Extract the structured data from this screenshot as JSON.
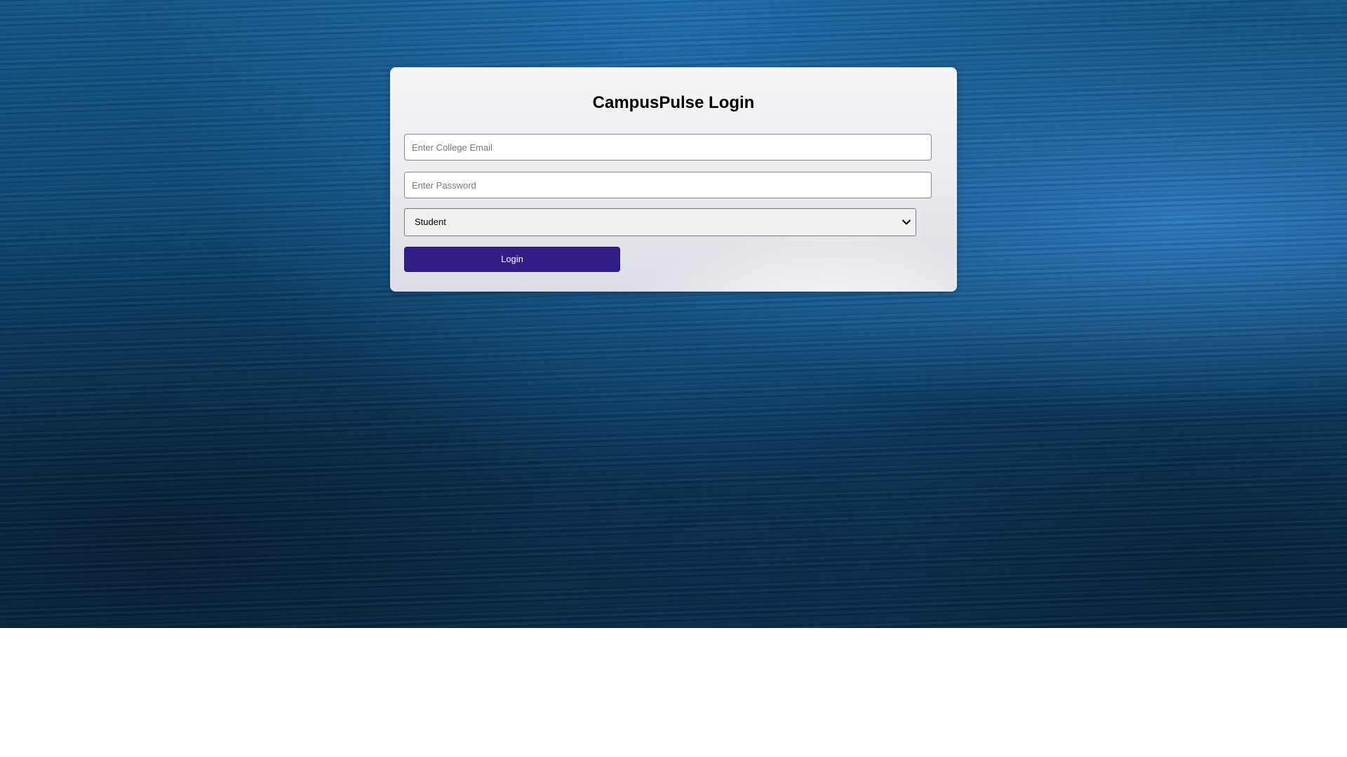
{
  "login": {
    "title": "CampusPulse Login",
    "email_placeholder": "Enter College Email",
    "password_placeholder": "Enter Password",
    "role_selected": "Student",
    "button_label": "Login"
  },
  "colors": {
    "button_bg": "#341d86",
    "background_blue": "#0e4772"
  },
  "icons": {
    "select_arrow": "chevron-down-icon"
  }
}
